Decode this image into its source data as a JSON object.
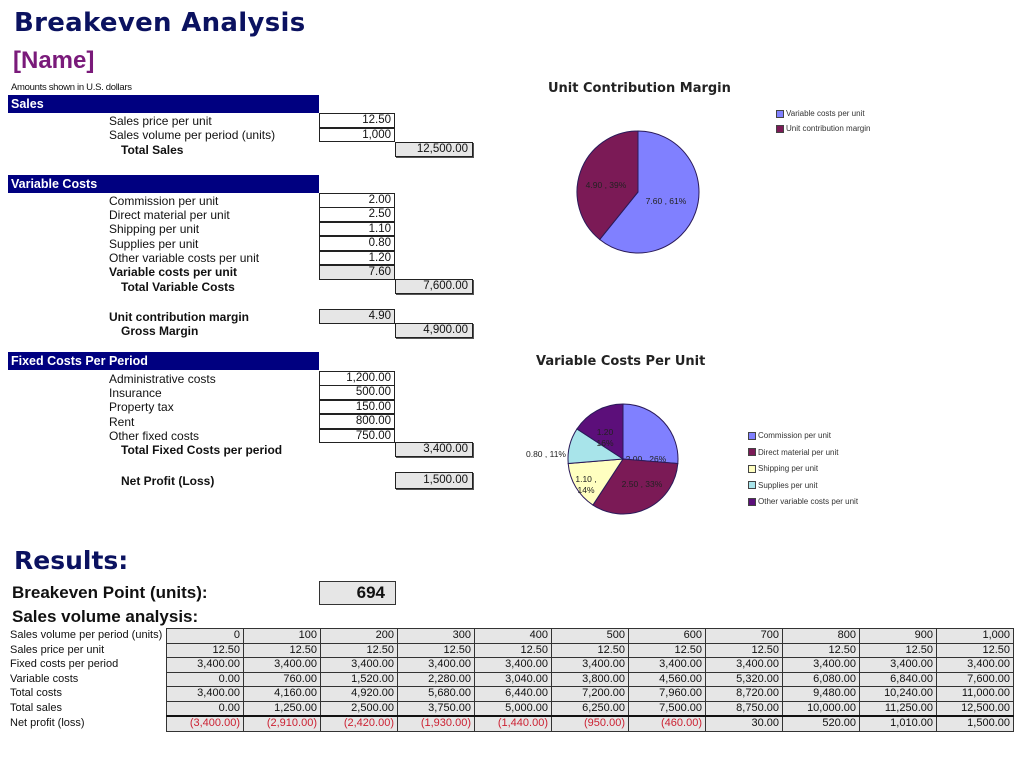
{
  "header": {
    "title": "Breakeven Analysis",
    "name": "[Name]",
    "note": "Amounts shown in U.S. dollars"
  },
  "sales": {
    "heading": "Sales",
    "price_label": "Sales price per unit",
    "price_value": "12.50",
    "volume_label": "Sales volume per period (units)",
    "volume_value": "1,000",
    "total_label": "Total Sales",
    "total_value": "12,500.00"
  },
  "variable_costs": {
    "heading": "Variable Costs",
    "items": [
      {
        "label": "Commission per unit",
        "value": "2.00"
      },
      {
        "label": "Direct material per unit",
        "value": "2.50"
      },
      {
        "label": "Shipping per unit",
        "value": "1.10"
      },
      {
        "label": "Supplies per unit",
        "value": "0.80"
      },
      {
        "label": "Other variable costs per unit",
        "value": "1.20"
      }
    ],
    "per_unit_label": "Variable costs per unit",
    "per_unit_value": "7.60",
    "total_label": "Total Variable Costs",
    "total_value": "7,600.00",
    "ucm_label": "Unit contribution margin",
    "ucm_value": "4.90",
    "gross_label": "Gross Margin",
    "gross_value": "4,900.00"
  },
  "fixed_costs": {
    "heading": "Fixed Costs Per Period",
    "items": [
      {
        "label": "Administrative costs",
        "value": "1,200.00"
      },
      {
        "label": "Insurance",
        "value": "500.00"
      },
      {
        "label": "Property tax",
        "value": "150.00"
      },
      {
        "label": "Rent",
        "value": "800.00"
      },
      {
        "label": "Other fixed costs",
        "value": "750.00"
      }
    ],
    "total_label": "Total Fixed Costs per period",
    "total_value": "3,400.00",
    "net_label": "Net Profit (Loss)",
    "net_value": "1,500.00"
  },
  "results": {
    "heading": "Results:",
    "bep_label": "Breakeven Point (units):",
    "bep_value": "694",
    "sva_label": "Sales volume analysis:",
    "row_labels": [
      "Sales volume per period (units)",
      "Sales price per unit",
      "Fixed costs per period",
      "Variable costs",
      "Total costs",
      "Total sales",
      "Net profit (loss)"
    ],
    "rows": [
      [
        "0",
        "100",
        "200",
        "300",
        "400",
        "500",
        "600",
        "700",
        "800",
        "900",
        "1,000"
      ],
      [
        "12.50",
        "12.50",
        "12.50",
        "12.50",
        "12.50",
        "12.50",
        "12.50",
        "12.50",
        "12.50",
        "12.50",
        "12.50"
      ],
      [
        "3,400.00",
        "3,400.00",
        "3,400.00",
        "3,400.00",
        "3,400.00",
        "3,400.00",
        "3,400.00",
        "3,400.00",
        "3,400.00",
        "3,400.00",
        "3,400.00"
      ],
      [
        "0.00",
        "760.00",
        "1,520.00",
        "2,280.00",
        "3,040.00",
        "3,800.00",
        "4,560.00",
        "5,320.00",
        "6,080.00",
        "6,840.00",
        "7,600.00"
      ],
      [
        "3,400.00",
        "4,160.00",
        "4,920.00",
        "5,680.00",
        "6,440.00",
        "7,200.00",
        "7,960.00",
        "8,720.00",
        "9,480.00",
        "10,240.00",
        "11,000.00"
      ],
      [
        "0.00",
        "1,250.00",
        "2,500.00",
        "3,750.00",
        "5,000.00",
        "6,250.00",
        "7,500.00",
        "8,750.00",
        "10,000.00",
        "11,250.00",
        "12,500.00"
      ],
      [
        "(3,400.00)",
        "(2,910.00)",
        "(2,420.00)",
        "(1,930.00)",
        "(1,440.00)",
        "(950.00)",
        "(460.00)",
        "30.00",
        "520.00",
        "1,010.00",
        "1,500.00"
      ]
    ]
  },
  "colors": {
    "section_header": "#000080",
    "title": "#0b1260",
    "name": "#7a1a7a",
    "negative": "#cc2233"
  },
  "chart_data": [
    {
      "type": "pie",
      "title": "Unit Contribution Margin",
      "legend_position": "right",
      "slices": [
        {
          "label": "Variable costs per unit",
          "value": 7.6,
          "percent": 61,
          "data_label": "7.60 , 61%",
          "color": "#8080ff"
        },
        {
          "label": "Unit contribution margin",
          "value": 4.9,
          "percent": 39,
          "data_label": "4.90 , 39%",
          "color": "#7b1a56"
        }
      ]
    },
    {
      "type": "pie",
      "title": "Variable Costs Per Unit",
      "legend_position": "right",
      "slices": [
        {
          "label": "Commission per unit",
          "value": 2.0,
          "percent": 26,
          "data_label": "2.00 , 26%",
          "color": "#8080ff"
        },
        {
          "label": "Direct material per unit",
          "value": 2.5,
          "percent": 33,
          "data_label": "2.50 , 33%",
          "color": "#7b1a56"
        },
        {
          "label": "Shipping per unit",
          "value": 1.1,
          "percent": 14,
          "data_label": "1.10 , 14%",
          "color": "#ffffc0"
        },
        {
          "label": "Supplies per unit",
          "value": 0.8,
          "percent": 11,
          "data_label": "0.80 , 11%",
          "color": "#a8e4ea"
        },
        {
          "label": "Other variable costs per unit",
          "value": 1.2,
          "percent": 16,
          "data_label": "1.20 , 16%",
          "color": "#5c0f7a"
        }
      ]
    }
  ]
}
